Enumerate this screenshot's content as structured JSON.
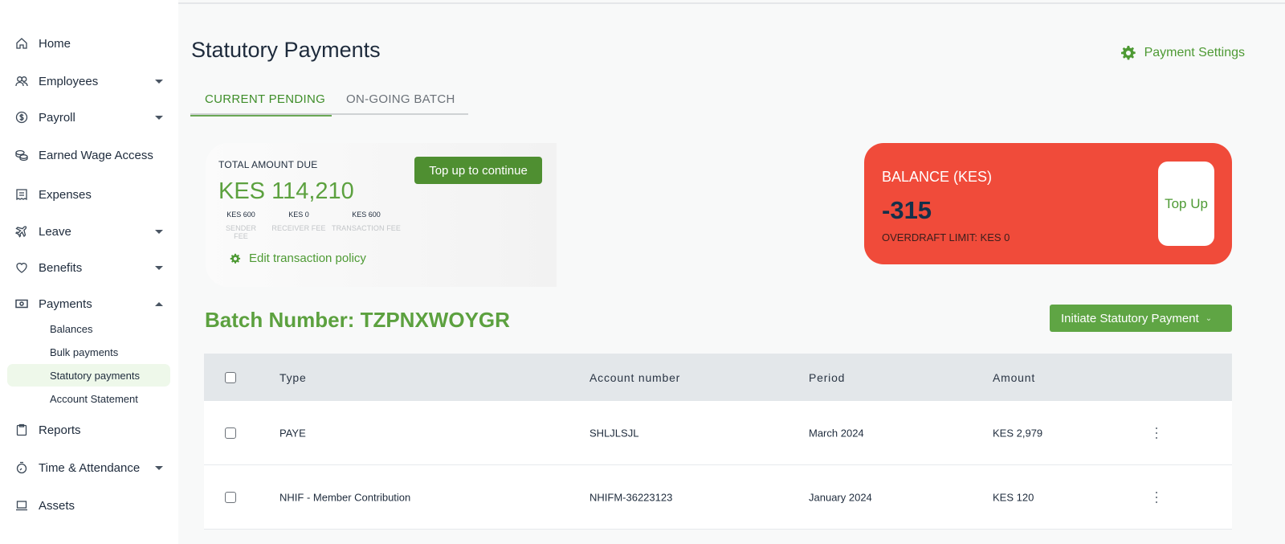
{
  "sidebar": {
    "items": [
      {
        "label": "Home",
        "icon": "home-icon"
      },
      {
        "label": "Employees",
        "icon": "users-icon"
      },
      {
        "label": "Payroll",
        "icon": "dollar-circle-icon"
      },
      {
        "label": "Earned Wage Access",
        "icon": "coins-icon"
      },
      {
        "label": "Expenses",
        "icon": "receipt-icon"
      },
      {
        "label": "Leave",
        "icon": "plane-icon"
      },
      {
        "label": "Benefits",
        "icon": "heart-icon"
      },
      {
        "label": "Payments",
        "icon": "banknote-icon"
      },
      {
        "label": "Reports",
        "icon": "clipboard-icon"
      },
      {
        "label": "Time & Attendance",
        "icon": "stopwatch-icon"
      },
      {
        "label": "Assets",
        "icon": "laptop-icon"
      }
    ],
    "payments_sub": [
      {
        "label": "Balances"
      },
      {
        "label": "Bulk payments"
      },
      {
        "label": "Statutory payments",
        "active": true
      },
      {
        "label": "Account Statement"
      }
    ]
  },
  "header": {
    "title": "Statutory Payments",
    "settings_label": "Payment Settings"
  },
  "tabs": [
    {
      "label": "CURRENT PENDING",
      "active": true
    },
    {
      "label": "ON-GOING BATCH",
      "active": false
    }
  ],
  "due_card": {
    "label": "TOTAL AMOUNT DUE",
    "amount": "KES 114,210",
    "topup_button": "Top up to continue",
    "fees": [
      {
        "value": "KES 600",
        "label": "SENDER FEE"
      },
      {
        "value": "KES 0",
        "label": "RECEIVER FEE"
      },
      {
        "value": "KES 600",
        "label": "TRANSACTION FEE"
      }
    ],
    "edit_policy": "Edit transaction policy"
  },
  "balance_card": {
    "label": "BALANCE (KES)",
    "value": "-315",
    "overdraft": "OVERDRAFT LIMIT: KES 0",
    "topup_button": "Top Up",
    "color": "#f04b3a"
  },
  "batch": {
    "title": "Batch Number: TZPNXWOYGR",
    "initiate_button": "Initiate Statutory Payment"
  },
  "table": {
    "columns": [
      "Type",
      "Account number",
      "Period",
      "Amount"
    ],
    "rows": [
      {
        "type": "PAYE",
        "account": "SHLJLSJL",
        "period": "March 2024",
        "amount": "KES 2,979"
      },
      {
        "type": "NHIF - Member Contribution",
        "account": "NHIFM-36223123",
        "period": "January 2024",
        "amount": "KES 120"
      }
    ]
  },
  "colors": {
    "accent_green": "#4e9a34",
    "balance_red": "#f04b3a"
  }
}
